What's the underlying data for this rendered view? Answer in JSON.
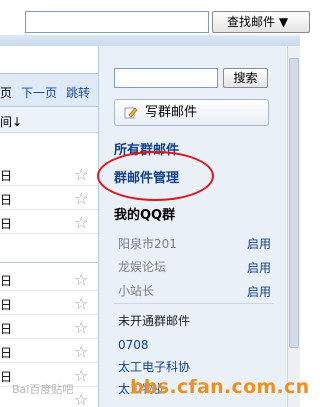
{
  "topbar": {
    "search_value": "",
    "search_button": "查找邮件 ▼"
  },
  "list": {
    "pager": {
      "prev": "页",
      "next": "下一页",
      "jump": "跳转"
    },
    "sort_label": "间↓",
    "row_date": "日",
    "star": "☆"
  },
  "sidebar": {
    "search_value": "",
    "search_button": "搜索",
    "compose_button": "写群邮件",
    "nav": {
      "all": "所有群邮件",
      "manage": "群邮件管理",
      "myqq": "我的QQ群"
    },
    "qq_groups": [
      {
        "name": "阳泉市201",
        "action": "启用"
      },
      {
        "name": "龙娱论坛",
        "action": "启用"
      },
      {
        "name": "小站长",
        "action": "启用"
      }
    ],
    "unopened_label": "未开通群邮件",
    "groups": [
      "0708",
      "太工电子科协",
      "太工物业"
    ]
  },
  "watermarks": {
    "left": "Bai百度贴吧",
    "right": "bbs.cfan.com.cn"
  },
  "colors": {
    "link": "#133f8a",
    "sidebar_bg": "#e9f0f8",
    "highlight": "#e0151d",
    "watermark": "#ee8f1f"
  }
}
